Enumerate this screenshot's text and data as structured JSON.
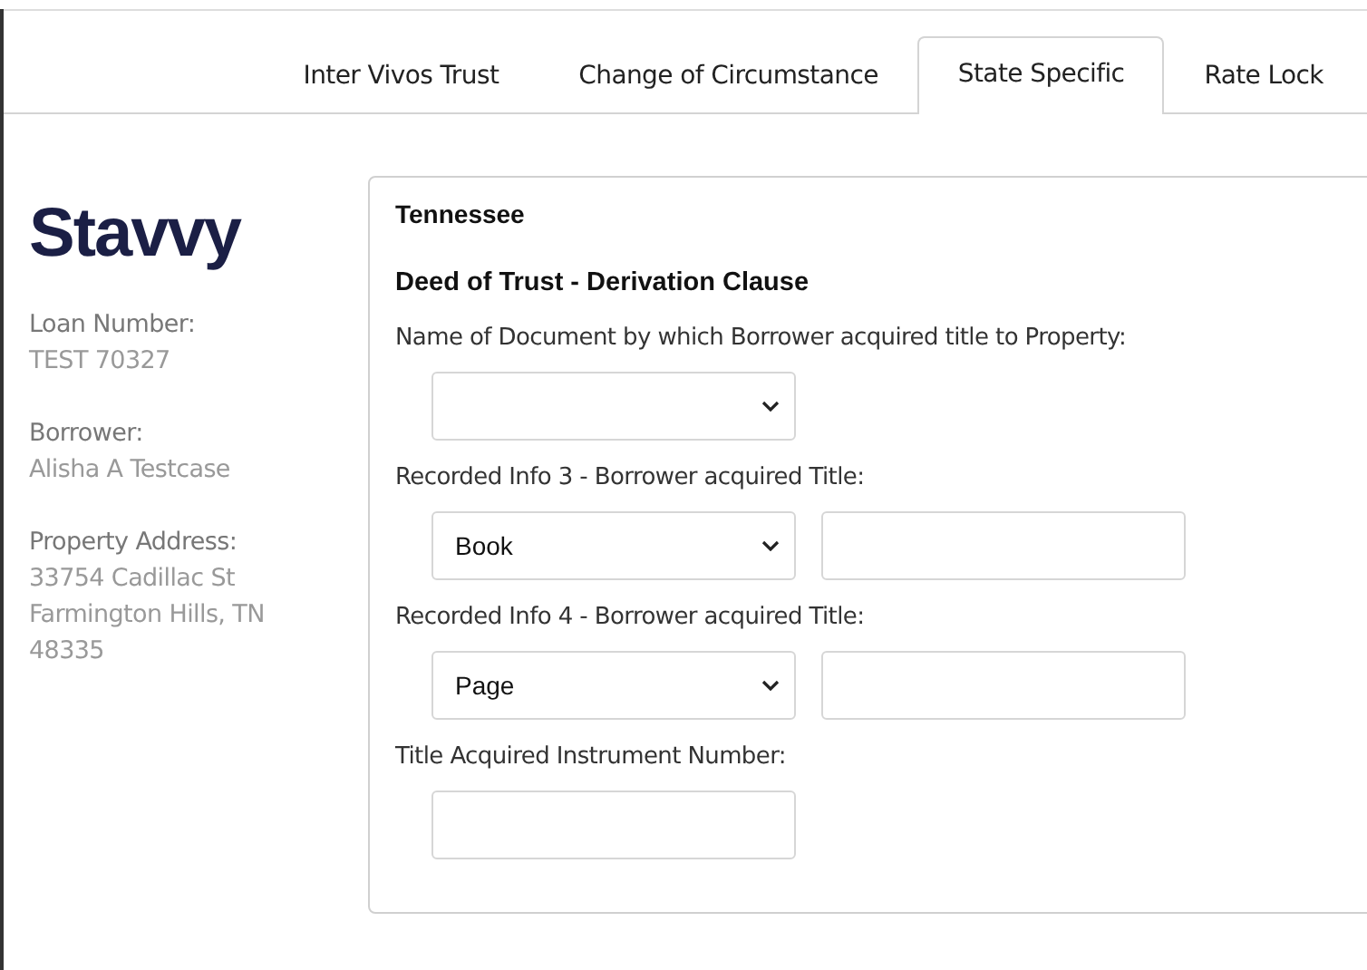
{
  "tabs": [
    {
      "label": "Inter Vivos Trust",
      "selected": false
    },
    {
      "label": "Change of Circumstance",
      "selected": false
    },
    {
      "label": "State Specific",
      "selected": true
    },
    {
      "label": "Rate Lock",
      "selected": false
    }
  ],
  "sidebar": {
    "logo": "Stavvy",
    "details": [
      {
        "label": "Loan Number:",
        "lines": [
          "TEST 70327"
        ]
      },
      {
        "label": "Borrower:",
        "lines": [
          "Alisha A Testcase"
        ]
      },
      {
        "label": "Property Address:",
        "lines": [
          "33754 Cadillac St",
          "Farmington Hills, TN",
          "48335"
        ]
      }
    ]
  },
  "panel": {
    "state": "Tennessee",
    "section": "Deed of Trust - Derivation Clause",
    "fields": [
      {
        "label": "Name of Document by which Borrower acquired title to Property:",
        "controls": [
          {
            "kind": "select"
          }
        ]
      },
      {
        "label": "Recorded Info 3 - Borrower acquired Title:",
        "controls": [
          {
            "kind": "select",
            "value": "Book"
          },
          {
            "kind": "text"
          }
        ]
      },
      {
        "label": "Recorded Info 4 - Borrower acquired Title:",
        "controls": [
          {
            "kind": "select",
            "value": "Page"
          },
          {
            "kind": "text"
          }
        ]
      },
      {
        "label": "Title Acquired Instrument Number:",
        "controls": [
          {
            "kind": "text"
          }
        ]
      }
    ]
  }
}
